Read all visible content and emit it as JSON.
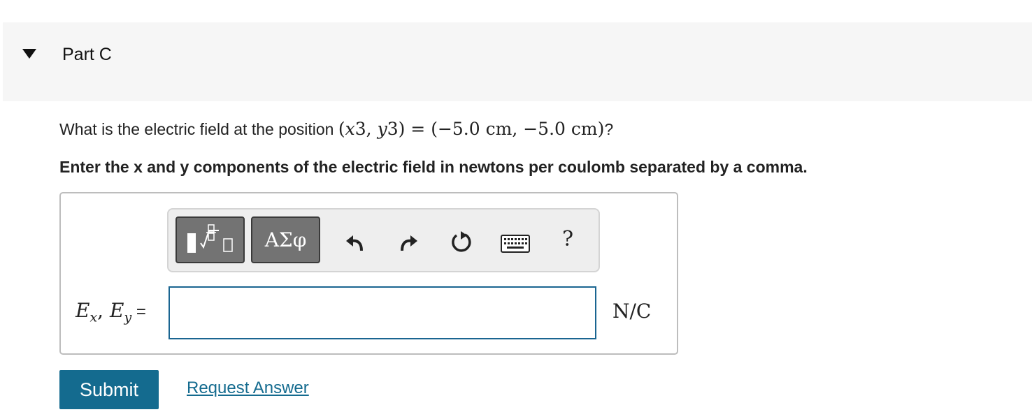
{
  "part": {
    "title": "Part C"
  },
  "question": {
    "prefix": "What is the electric field at the position ",
    "math": {
      "open": "(",
      "x": "x",
      "x_sub": "3",
      "comma": ",  ",
      "y": "y",
      "y_sub": "3",
      "close": ")",
      "eq": " = ",
      "value": "(−5.0 cm,  −5.0 cm)"
    },
    "suffix": "?",
    "instructions": "Enter the x and y components of the electric field in newtons per coulomb separated by a comma."
  },
  "toolbar": {
    "templates_icon": "templates-icon",
    "greek_label": "ΑΣφ",
    "undo_icon": "undo-icon",
    "redo_icon": "redo-icon",
    "reset_icon": "reset-icon",
    "keyboard_icon": "keyboard-icon",
    "help_label": "?"
  },
  "answer": {
    "label_e1": "E",
    "label_sub1": "x",
    "label_comma": ", ",
    "label_e2": "E",
    "label_sub2": "y",
    "label_eq": " =",
    "value": "",
    "units": "N/C"
  },
  "actions": {
    "submit_label": "Submit",
    "request_label": "Request Answer"
  },
  "colors": {
    "accent": "#146b8f",
    "header_bg": "#f6f6f6"
  }
}
